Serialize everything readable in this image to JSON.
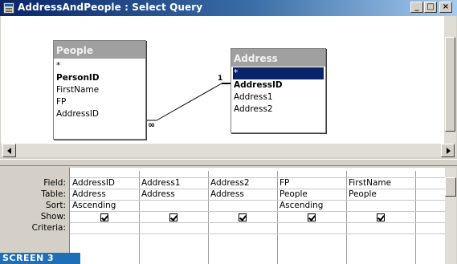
{
  "window": {
    "title": "AddressAndPeople : Select Query",
    "minimize_glyph": "_",
    "maximize_glyph": "□",
    "close_glyph": "×"
  },
  "tables": [
    {
      "name": "People",
      "fields": [
        {
          "name": "*",
          "key": false,
          "selected": false
        },
        {
          "name": "PersonID",
          "key": true,
          "selected": false
        },
        {
          "name": "FirstName",
          "key": false,
          "selected": false
        },
        {
          "name": "FP",
          "key": false,
          "selected": false
        },
        {
          "name": "AddressID",
          "key": false,
          "selected": false
        }
      ]
    },
    {
      "name": "Address",
      "fields": [
        {
          "name": "*",
          "key": false,
          "selected": true
        },
        {
          "name": "AddressID",
          "key": true,
          "selected": false
        },
        {
          "name": "Address1",
          "key": false,
          "selected": false
        },
        {
          "name": "Address2",
          "key": false,
          "selected": false
        }
      ]
    }
  ],
  "join": {
    "one_side_label": "1",
    "many_side_label": "∞"
  },
  "grid": {
    "row_labels": [
      "Field:",
      "Table:",
      "Sort:",
      "Show:",
      "Criteria:"
    ],
    "columns": [
      {
        "field": "AddressID",
        "table": "Address",
        "sort": "Ascending",
        "show": true
      },
      {
        "field": "Address1",
        "table": "Address",
        "sort": "",
        "show": true
      },
      {
        "field": "Address2",
        "table": "Address",
        "sort": "",
        "show": true
      },
      {
        "field": "FP",
        "table": "People",
        "sort": "Ascending",
        "show": true
      },
      {
        "field": "FirstName",
        "table": "People",
        "sort": "",
        "show": true
      }
    ]
  },
  "caption": "SCREEN 3"
}
